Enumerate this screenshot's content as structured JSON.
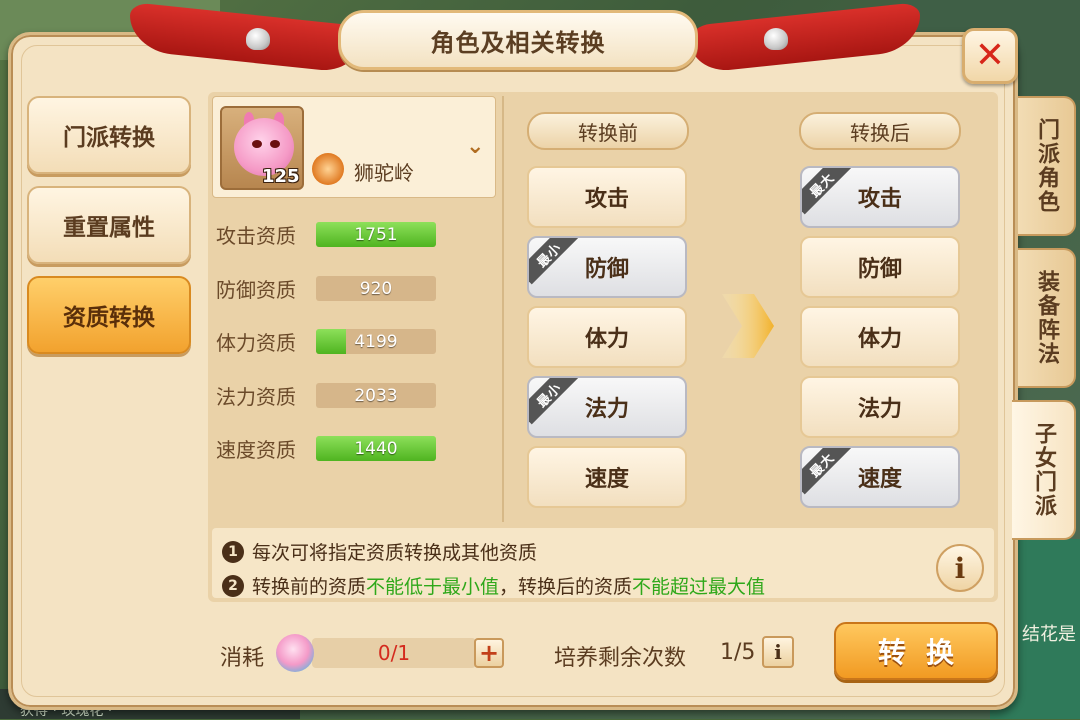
{
  "dialog": {
    "title": "角色及相关转换",
    "close_label": "✕"
  },
  "left_tabs": [
    {
      "label": "门派转换",
      "active": false
    },
    {
      "label": "重置属性",
      "active": false
    },
    {
      "label": "资质转换",
      "active": true
    }
  ],
  "side_tabs": [
    {
      "label": "门派角色",
      "active": false
    },
    {
      "label": "装备阵法",
      "active": false
    },
    {
      "label": "子女门派",
      "active": true
    }
  ],
  "character": {
    "level": "125",
    "school": "狮驼岭",
    "dropdown_icon": "chevron-down"
  },
  "stats": [
    {
      "label": "攻击资质",
      "value": "1751",
      "fill": 1.0
    },
    {
      "label": "防御资质",
      "value": "920",
      "fill": 0.0
    },
    {
      "label": "体力资质",
      "value": "4199",
      "fill": 0.25
    },
    {
      "label": "法力资质",
      "value": "2033",
      "fill": 0.0
    },
    {
      "label": "速度资质",
      "value": "1440",
      "fill": 1.0
    }
  ],
  "before": {
    "header": "转换前",
    "options": [
      {
        "label": "攻击",
        "tag": "",
        "selected": false
      },
      {
        "label": "防御",
        "tag": "最小",
        "selected": true
      },
      {
        "label": "体力",
        "tag": "",
        "selected": false
      },
      {
        "label": "法力",
        "tag": "最小",
        "selected": true
      },
      {
        "label": "速度",
        "tag": "",
        "selected": false
      }
    ]
  },
  "after": {
    "header": "转换后",
    "options": [
      {
        "label": "攻击",
        "tag": "最大",
        "selected": true
      },
      {
        "label": "防御",
        "tag": "",
        "selected": false
      },
      {
        "label": "体力",
        "tag": "",
        "selected": false
      },
      {
        "label": "法力",
        "tag": "",
        "selected": false
      },
      {
        "label": "速度",
        "tag": "最大",
        "selected": true
      }
    ]
  },
  "notes": {
    "line1": {
      "num": "1",
      "text": "每次可将指定资质转换成其他资质"
    },
    "line2": {
      "num": "2",
      "part1": "转换前的资质",
      "part2": "不能低于最小值",
      "part3": "，转换后的资质",
      "part4": "不能超过最大值"
    },
    "info_label": "i"
  },
  "bottom": {
    "cost_label": "消耗",
    "cost_value": "0/1",
    "plus_label": "+",
    "remain_label": "培养剩余次数",
    "remain_value": "1/5",
    "remain_info": "i",
    "convert_label": "转换"
  },
  "background_text": {
    "bottom_left": "获得 ·  玫瑰花 ·",
    "right_edge": "结花是 明。"
  },
  "colors": {
    "accent_orange": "#f19a22",
    "green_fill": "#4fb420",
    "warning_green": "#2fa81a",
    "red_value": "#d42a1e"
  }
}
